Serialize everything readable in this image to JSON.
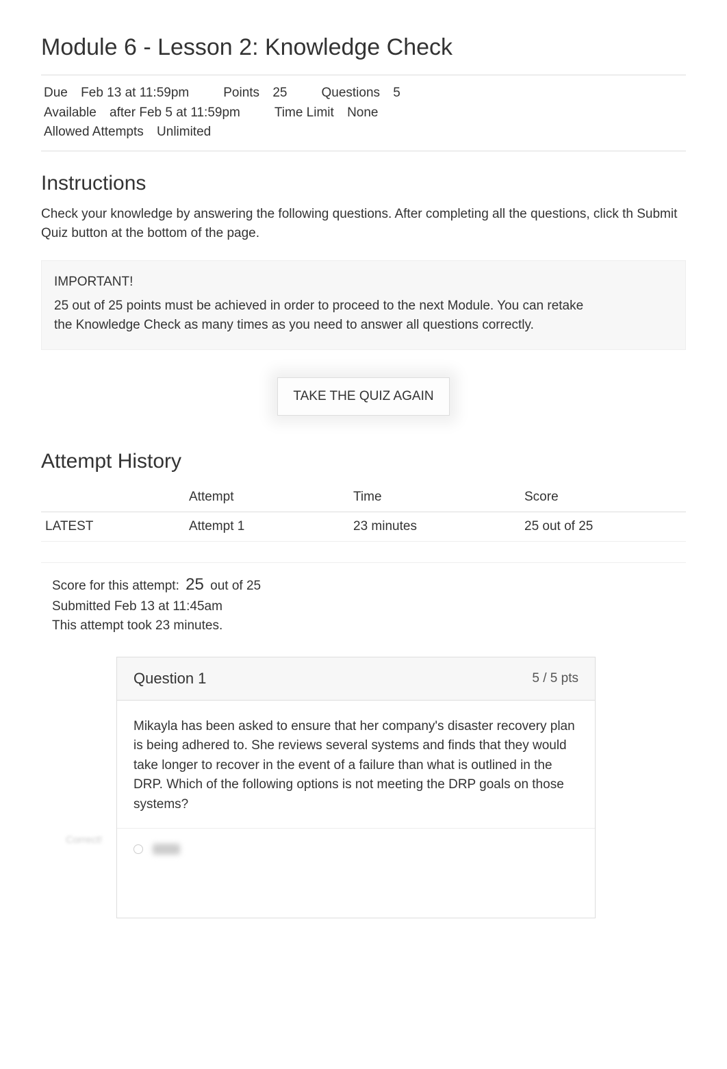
{
  "title": "Module 6 - Lesson 2: Knowledge Check",
  "meta": {
    "due_label": "Due",
    "due_value": "Feb 13 at 11:59pm",
    "points_label": "Points",
    "points_value": "25",
    "questions_label": "Questions",
    "questions_value": "5",
    "available_label": "Available",
    "available_value": "after Feb 5 at 11:59pm",
    "timelimit_label": "Time Limit",
    "timelimit_value": "None",
    "attempts_label": "Allowed Attempts",
    "attempts_value": "Unlimited"
  },
  "instructions": {
    "heading": "Instructions",
    "body": "Check your knowledge by answering the following questions. After completing all the questions, click th Submit Quiz button at the bottom of the page."
  },
  "important": {
    "title": "IMPORTANT!",
    "body": "25 out of 25 points must be achieved in order to proceed to the next Module. You can retake the Knowledge Check as many times as you need to answer all questions correctly."
  },
  "take_again_label": "TAKE THE QUIZ AGAIN",
  "history": {
    "heading": "Attempt History",
    "headers": {
      "status": "",
      "attempt": "Attempt",
      "time": "Time",
      "score": "Score"
    },
    "rows": [
      {
        "status": "LATEST",
        "attempt": "Attempt 1",
        "time": "23 minutes",
        "score": "25 out of 25"
      }
    ]
  },
  "summary": {
    "score_label": "Score for this attempt:",
    "score_num": "25",
    "score_suffix": "out of 25",
    "submitted": "Submitted Feb 13 at 11:45am",
    "duration": "This attempt took 23 minutes."
  },
  "question1": {
    "title": "Question 1",
    "pts": "5 / 5 pts",
    "body": "Mikayla has been asked to ensure that her company's disaster recovery plan is being adhered to. She reviews several systems and finds that they would take longer to recover in the event of a failure than what is outlined in the DRP. Which of the following options is not meeting the DRP goals on those systems?",
    "correct_hint": "Correct!"
  }
}
